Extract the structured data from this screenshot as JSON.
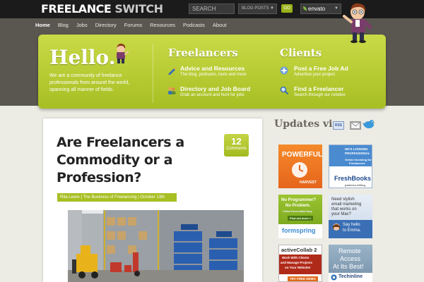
{
  "header": {
    "logo_part1": "FREELANCE",
    "logo_part2": "SWITCH",
    "search_placeholder": "SEARCH",
    "search_scope": "BLOG POSTS",
    "go_label": "GO",
    "network_label": "envato"
  },
  "nav": {
    "items": [
      "Home",
      "Blog",
      "Jobs",
      "Directory",
      "Forums",
      "Resources",
      "Podcasts",
      "About"
    ],
    "active": "Home"
  },
  "hero": {
    "hello": "Hello.",
    "intro": "We are a community of freelance professionals from around the world, spanning all manner of fields.",
    "freelancers_title": "Freelancers",
    "clients_title": "Clients",
    "items": [
      {
        "title": "Advice and Resources",
        "desc": "The blog, podcasts, tools and more"
      },
      {
        "title": "Directory and Job Board",
        "desc": "Grab an account and hunt for jobs"
      },
      {
        "title": "Post a Free Job Ad",
        "desc": "Advertise your project"
      },
      {
        "title": "Find a Freelancer",
        "desc": "Search through our rolodex"
      }
    ]
  },
  "post": {
    "title": "Are Freelancers a Commodity or a Profession?",
    "comment_count": "12",
    "comment_label": "Comments",
    "meta": "Rita Lewis | The Business of Freelancing | October 13th"
  },
  "sidebar": {
    "updates_title": "Updates via",
    "rss_label": "RSS",
    "ads": {
      "harvest": {
        "headline": "POWERFUL",
        "brand": "HARVEST"
      },
      "freshbooks": {
        "line1": "HE'S LOOKING",
        "line2": "PROFESSIONAL",
        "line3": "Online Invoicing for",
        "line4": "Freelancers",
        "brand": "FreshBooks",
        "tagline": "painless billing"
      },
      "formspring": {
        "line1": "No Programmer?",
        "line2": "No Problem.",
        "line3": "Online Forms Made Easy",
        "cta": "Find out more »",
        "brand": "formspring"
      },
      "emma": {
        "line1": "Need stylish",
        "line2": "email marketing",
        "line3": "that works on",
        "line4": "your Mac?",
        "cta1": "Say hello",
        "cta2": "to Emma."
      },
      "activecollab": {
        "brand": "activeCollab 2",
        "line1": "Work With Clients",
        "line2": "and Manage Projects",
        "line3": "on Your Website!",
        "cta": "TRY FREE DEMO"
      },
      "remote": {
        "line1": "Remote",
        "line2": "Access",
        "line3": "At Its Best!",
        "brand": "Techinline"
      }
    }
  },
  "colors": {
    "accent_green": "#a7bf22",
    "top_bar": "#1b1b1b",
    "nav_band": "#5a5750",
    "page_bg": "#ecebe4"
  }
}
